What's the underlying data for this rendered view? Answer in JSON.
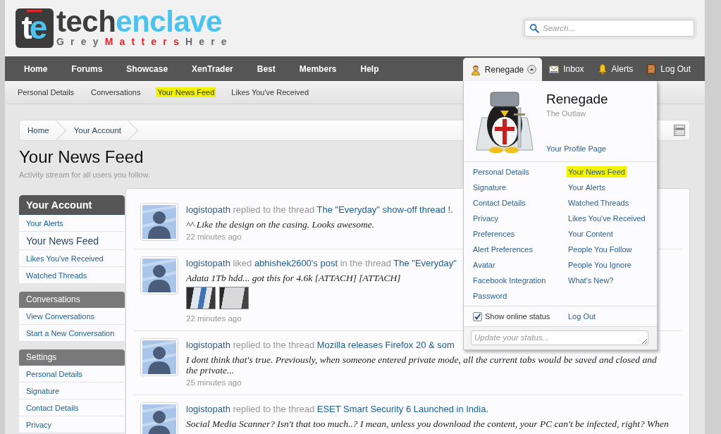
{
  "header": {
    "logo": {
      "mark": "te",
      "wordmark": [
        "tech",
        "enclave"
      ],
      "tagline": [
        "Grey",
        "Matters",
        "Here"
      ]
    },
    "search": {
      "placeholder": "Search..."
    }
  },
  "nav": {
    "items": [
      "Home",
      "Forums",
      "Showcase",
      "XenTrader",
      "Best",
      "Members",
      "Help"
    ],
    "user_items": [
      {
        "label": "Renegade",
        "kind": "account",
        "selected": true
      },
      {
        "label": "Inbox",
        "kind": "inbox",
        "selected": false
      },
      {
        "label": "Alerts",
        "kind": "alerts",
        "selected": false
      },
      {
        "label": "Log Out",
        "kind": "logout",
        "selected": false
      }
    ]
  },
  "subnav": {
    "items": [
      {
        "label": "Personal Details",
        "highlighted": false
      },
      {
        "label": "Conversations",
        "highlighted": false
      },
      {
        "label": "Your News Feed",
        "highlighted": true
      },
      {
        "label": "Likes You've Received",
        "highlighted": false
      }
    ]
  },
  "breadcrumb": [
    "Home",
    "Your Account"
  ],
  "page": {
    "title": "Your News Feed",
    "description": "Activity stream for all users you follow."
  },
  "sidebar": {
    "sections": [
      {
        "title": "Your Account",
        "kind": "main",
        "items": [
          {
            "label": "Your Alerts",
            "selected": false
          },
          {
            "label": "Your News Feed",
            "selected": true
          },
          {
            "label": "Likes You've Received",
            "selected": false
          },
          {
            "label": "Watched Threads",
            "selected": false
          }
        ]
      },
      {
        "title": "Conversations",
        "kind": "sub",
        "items": [
          {
            "label": "View Conversations",
            "selected": false
          },
          {
            "label": "Start a New Conversation",
            "selected": false
          }
        ]
      },
      {
        "title": "Settings",
        "kind": "sub",
        "items": [
          {
            "label": "Personal Details",
            "selected": false
          },
          {
            "label": "Signature",
            "selected": false
          },
          {
            "label": "Contact Details",
            "selected": false
          },
          {
            "label": "Privacy",
            "selected": false
          }
        ]
      }
    ]
  },
  "feed": {
    "items": [
      {
        "headline": [
          {
            "text": "logistopath",
            "kind": "user"
          },
          {
            "text": "replied to the thread",
            "kind": "text"
          },
          {
            "text": "The \"Everyday\" show-off thread !.",
            "kind": "link"
          }
        ],
        "excerpt": "^^ Like the design on the casing. Looks awesome.",
        "time": "22 minutes ago"
      },
      {
        "headline": [
          {
            "text": "logistopath",
            "kind": "user"
          },
          {
            "text": "liked",
            "kind": "text"
          },
          {
            "text": "abhishek2600's post",
            "kind": "link"
          },
          {
            "text": "in the thread",
            "kind": "text"
          },
          {
            "text": "The \"Everyday\"",
            "kind": "link"
          }
        ],
        "excerpt": "Adata 1Tb hdd... got this for 4.6k [ATTACH] [ATTACH]",
        "thumbnails": [
          {
            "kind": "photo"
          },
          {
            "kind": "photo"
          }
        ],
        "time": "22 minutes ago"
      },
      {
        "headline": [
          {
            "text": "logistopath",
            "kind": "user"
          },
          {
            "text": "replied to the thread",
            "kind": "text"
          },
          {
            "text": "Mozilla releases Firefox 20 & som",
            "kind": "link"
          }
        ],
        "excerpt": "I dont think that's true. Previously, when someone entered private mode, all the current tabs would be saved and closed and the private...",
        "time": "25 minutes ago"
      },
      {
        "headline": [
          {
            "text": "logistopath",
            "kind": "user"
          },
          {
            "text": "replied to the thread",
            "kind": "text"
          },
          {
            "text": "ESET Smart Security 6 Launched in India.",
            "kind": "link"
          }
        ],
        "excerpt": "Social Media Scanner? Isn't that too much..? I mean, unless you download the content, your PC can't be infected, right? When"
      }
    ]
  },
  "account_menu": {
    "name": "Renegade",
    "title": "The Outlaw",
    "profile_link": "Your Profile Page",
    "left_links": [
      "Personal Details",
      "Signature",
      "Contact Details",
      "Privacy",
      "Preferences",
      "Alert Preferences",
      "Avatar",
      "Facebook Integration",
      "Password"
    ],
    "right_links": [
      {
        "label": "Your News Feed",
        "highlighted": true
      },
      {
        "label": "Your Alerts",
        "highlighted": false
      },
      {
        "label": "Watched Threads",
        "highlighted": false
      },
      {
        "label": "Likes You've Received",
        "highlighted": false
      },
      {
        "label": "Your Content",
        "highlighted": false
      },
      {
        "label": "People You Follow",
        "highlighted": false
      },
      {
        "label": "People You Ignore",
        "highlighted": false
      },
      {
        "label": "What's New?",
        "highlighted": false
      }
    ],
    "online_status": {
      "label": "Show online status",
      "checked": true
    },
    "logout": "Log Out",
    "status_field": {
      "placeholder": "Update your status..."
    }
  }
}
